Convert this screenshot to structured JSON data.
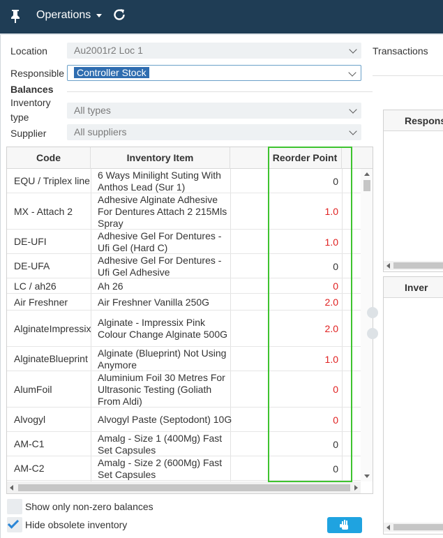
{
  "topbar": {
    "menu_label": "Operations",
    "pin_icon": "pin-icon",
    "refresh_icon": "refresh-icon",
    "background": "#1f3d55"
  },
  "filters": {
    "location_label": "Location",
    "location_value": "Au2001r2 Loc 1",
    "responsible_label": "Responsible",
    "responsible_value": "Controller Stock",
    "section_title": "Balances",
    "inventory_type_label_1": "Inventory",
    "inventory_type_label_2": "type",
    "inventory_type_value": "All types",
    "supplier_label": "Supplier",
    "supplier_value": "All suppliers"
  },
  "transactions_label": "Transactions",
  "table": {
    "headers": {
      "code": "Code",
      "item": "Inventory Item",
      "reorder": "Reorder Point"
    },
    "rows": [
      {
        "code": "EQU / Triplex line",
        "item": "6 Ways Minilight Suting With Anthos Lead (Sur 1)",
        "reorder": "0",
        "alert": false
      },
      {
        "code": "MX - Attach 2",
        "item": "Adhesive Alginate Adhesive For Dentures Attach 2 215Mls Spray",
        "reorder": "1.0",
        "alert": true
      },
      {
        "code": "DE-UFI",
        "item": "Adhesive Gel For Dentures - Ufi Gel (Hard C)",
        "reorder": "1.0",
        "alert": true
      },
      {
        "code": "DE-UFA",
        "item": "Adhesive Gel For Dentures - Ufi Gel Adhesive",
        "reorder": "0",
        "alert": false
      },
      {
        "code": "LC / ah26",
        "item": "Ah 26",
        "reorder": "0",
        "alert": true
      },
      {
        "code": "Air Freshner",
        "item": "Air Freshner Vanilla 250G",
        "reorder": "2.0",
        "alert": true
      },
      {
        "code": "AlginateImpressix",
        "item": "Alginate - Impressix Pink Colour Change Alginate 500G",
        "reorder": "2.0",
        "alert": true
      },
      {
        "code": "AlginateBlueprint",
        "item": "Alginate (Blueprint) Not Using Anymore",
        "reorder": "1.0",
        "alert": true
      },
      {
        "code": "AlumFoil",
        "item": "Aluminium Foil 30 Metres For Ultrasonic Testing (Goliath From Aldi)",
        "reorder": "0",
        "alert": true
      },
      {
        "code": "Alvogyl",
        "item": "Alvogyl Paste (Septodont) 10G",
        "reorder": "0",
        "alert": true
      },
      {
        "code": "AM-C1",
        "item": "Amalg - Size 1 (400Mg) Fast Set Capsules",
        "reorder": "0",
        "alert": false
      },
      {
        "code": "AM-C2",
        "item": "Amalg - Size 2 (600Mg) Fast Set Capsules",
        "reorder": "0",
        "alert": false
      }
    ]
  },
  "options": {
    "nonzero_label": "Show only non-zero balances",
    "nonzero_checked": false,
    "obsolete_label": "Hide obsolete inventory",
    "obsolete_checked": true
  },
  "side_panels": {
    "top_title": "Respons",
    "bottom_title": "Inver"
  },
  "colors": {
    "alert": "#e02020",
    "highlight": "#3ec32e",
    "accent": "#1fa3e0"
  }
}
